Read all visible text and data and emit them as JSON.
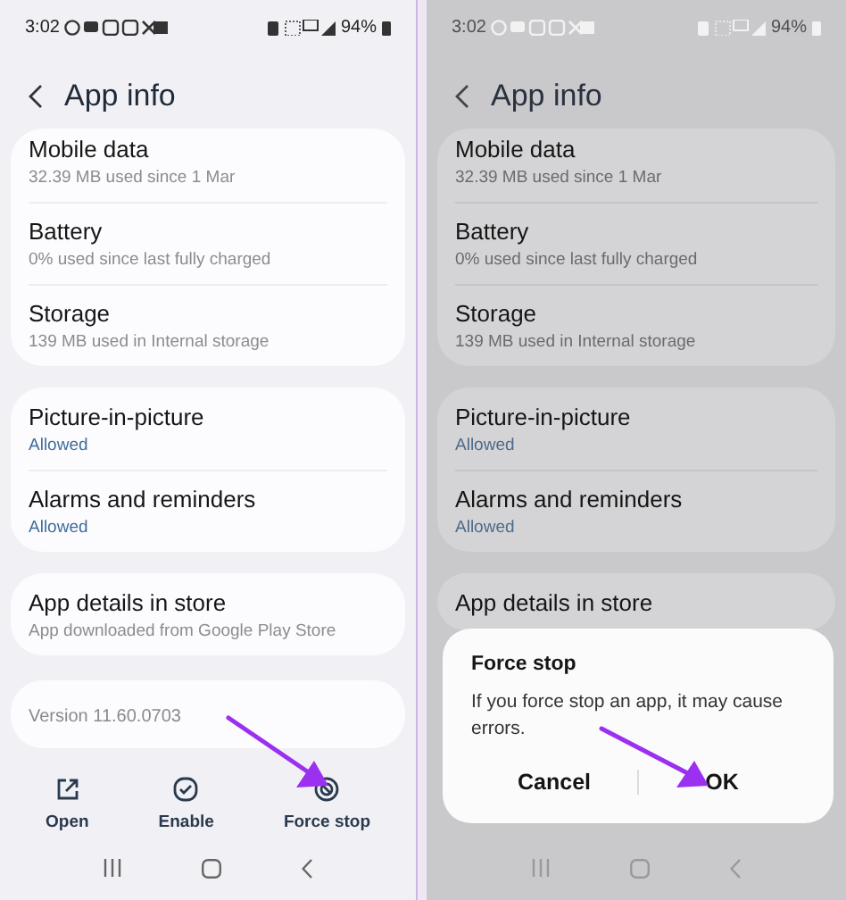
{
  "screens": [
    {
      "dimmed": false,
      "status_bar": {
        "time": "3:02",
        "battery": "94%"
      },
      "title": "App info",
      "groups": [
        [
          {
            "title": "Mobile data",
            "subtitle": "32.39 MB used since 1 Mar",
            "accent": false
          },
          {
            "title": "Battery",
            "subtitle": "0% used since last fully charged",
            "accent": false
          },
          {
            "title": "Storage",
            "subtitle": "139 MB used in Internal storage",
            "accent": false
          }
        ],
        [
          {
            "title": "Picture-in-picture",
            "subtitle": "Allowed",
            "accent": true
          },
          {
            "title": "Alarms and reminders",
            "subtitle": "Allowed",
            "accent": true
          }
        ],
        [
          {
            "title": "App details in store",
            "subtitle": "App downloaded from Google Play Store",
            "accent": false
          }
        ]
      ],
      "version": "Version 11.60.0703",
      "actions": [
        {
          "label": "Open",
          "kind": "open"
        },
        {
          "label": "Enable",
          "kind": "enable"
        },
        {
          "label": "Force stop",
          "kind": "stop"
        }
      ]
    },
    {
      "dimmed": true,
      "status_bar": {
        "time": "3:02",
        "battery": "94%"
      },
      "title": "App info",
      "groups": [
        [
          {
            "title": "Mobile data",
            "subtitle": "32.39 MB used since 1 Mar",
            "accent": false
          },
          {
            "title": "Battery",
            "subtitle": "0% used since last fully charged",
            "accent": false
          },
          {
            "title": "Storage",
            "subtitle": "139 MB used in Internal storage",
            "accent": false
          }
        ],
        [
          {
            "title": "Picture-in-picture",
            "subtitle": "Allowed",
            "accent": true
          },
          {
            "title": "Alarms and reminders",
            "subtitle": "Allowed",
            "accent": true
          }
        ],
        [
          {
            "title": "App details in store"
          }
        ]
      ],
      "dialog": {
        "title": "Force stop",
        "message": "If you force stop an app, it may cause errors.",
        "buttons": [
          "Cancel",
          "OK"
        ]
      }
    }
  ]
}
